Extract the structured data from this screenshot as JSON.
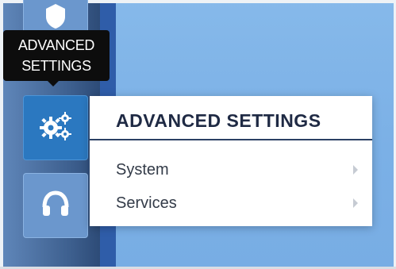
{
  "tooltip": {
    "line1": "ADVANCED",
    "line2": "SETTINGS"
  },
  "sidebar": {
    "buttons": [
      {
        "name": "top-partial",
        "icon": "shield-icon"
      },
      {
        "name": "advanced-settings",
        "icon": "gears-icon",
        "active": true
      },
      {
        "name": "support",
        "icon": "headset-icon"
      }
    ]
  },
  "menu": {
    "title": "ADVANCED SETTINGS",
    "items": [
      {
        "label": "System",
        "icon": "chevron-right-icon"
      },
      {
        "label": "Services",
        "icon": "chevron-right-icon"
      }
    ]
  },
  "colors": {
    "active_button": "#2b78c0",
    "menu_title": "#1f2a44",
    "tooltip_bg": "#0d0d0d"
  }
}
